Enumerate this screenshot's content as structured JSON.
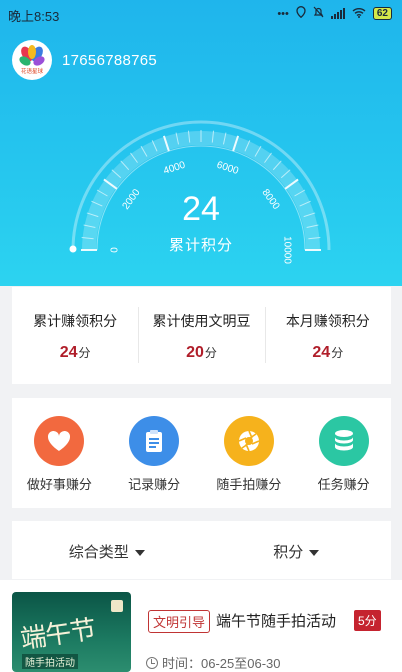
{
  "status_bar": {
    "time": "晚上8:53",
    "icons": [
      "more-dots-icon",
      "location-icon",
      "mute-bell-icon",
      "signal-icon",
      "wifi-icon"
    ],
    "battery": "62"
  },
  "profile": {
    "avatar_text": "花语星球",
    "phone": "17656788765"
  },
  "gauge": {
    "ticks": [
      "0",
      "2000",
      "4000",
      "6000",
      "8000",
      "10000"
    ],
    "value": "24",
    "label": "累计积分",
    "max": 10000,
    "current": 24
  },
  "stats": [
    {
      "label": "累计赚领积分",
      "value": "24",
      "unit": "分"
    },
    {
      "label": "累计使用文明豆",
      "value": "20",
      "unit": "分"
    },
    {
      "label": "本月赚领积分",
      "value": "24",
      "unit": "分"
    }
  ],
  "actions": [
    {
      "label": "做好事赚分",
      "icon": "heart-icon",
      "color": "#f2693f"
    },
    {
      "label": "记录赚分",
      "icon": "clipboard-icon",
      "color": "#3d8ee8"
    },
    {
      "label": "随手拍赚分",
      "icon": "camera-aperture-icon",
      "color": "#f6b21c"
    },
    {
      "label": "任务赚分",
      "icon": "database-icon",
      "color": "#2bc7a3"
    }
  ],
  "filters": [
    {
      "label": "综合类型"
    },
    {
      "label": "积分"
    }
  ],
  "activity": {
    "thumb_title": "端午节",
    "thumb_subtitle": "随手拍活动",
    "tag": "文明引导",
    "title": "端午节随手拍活动",
    "points": "5分",
    "time": "时间：06-25至06-30"
  },
  "colors": {
    "hero_top": "#1fb5ec",
    "hero_bottom": "#2cd3f0",
    "accent_red": "#b01e2a"
  }
}
